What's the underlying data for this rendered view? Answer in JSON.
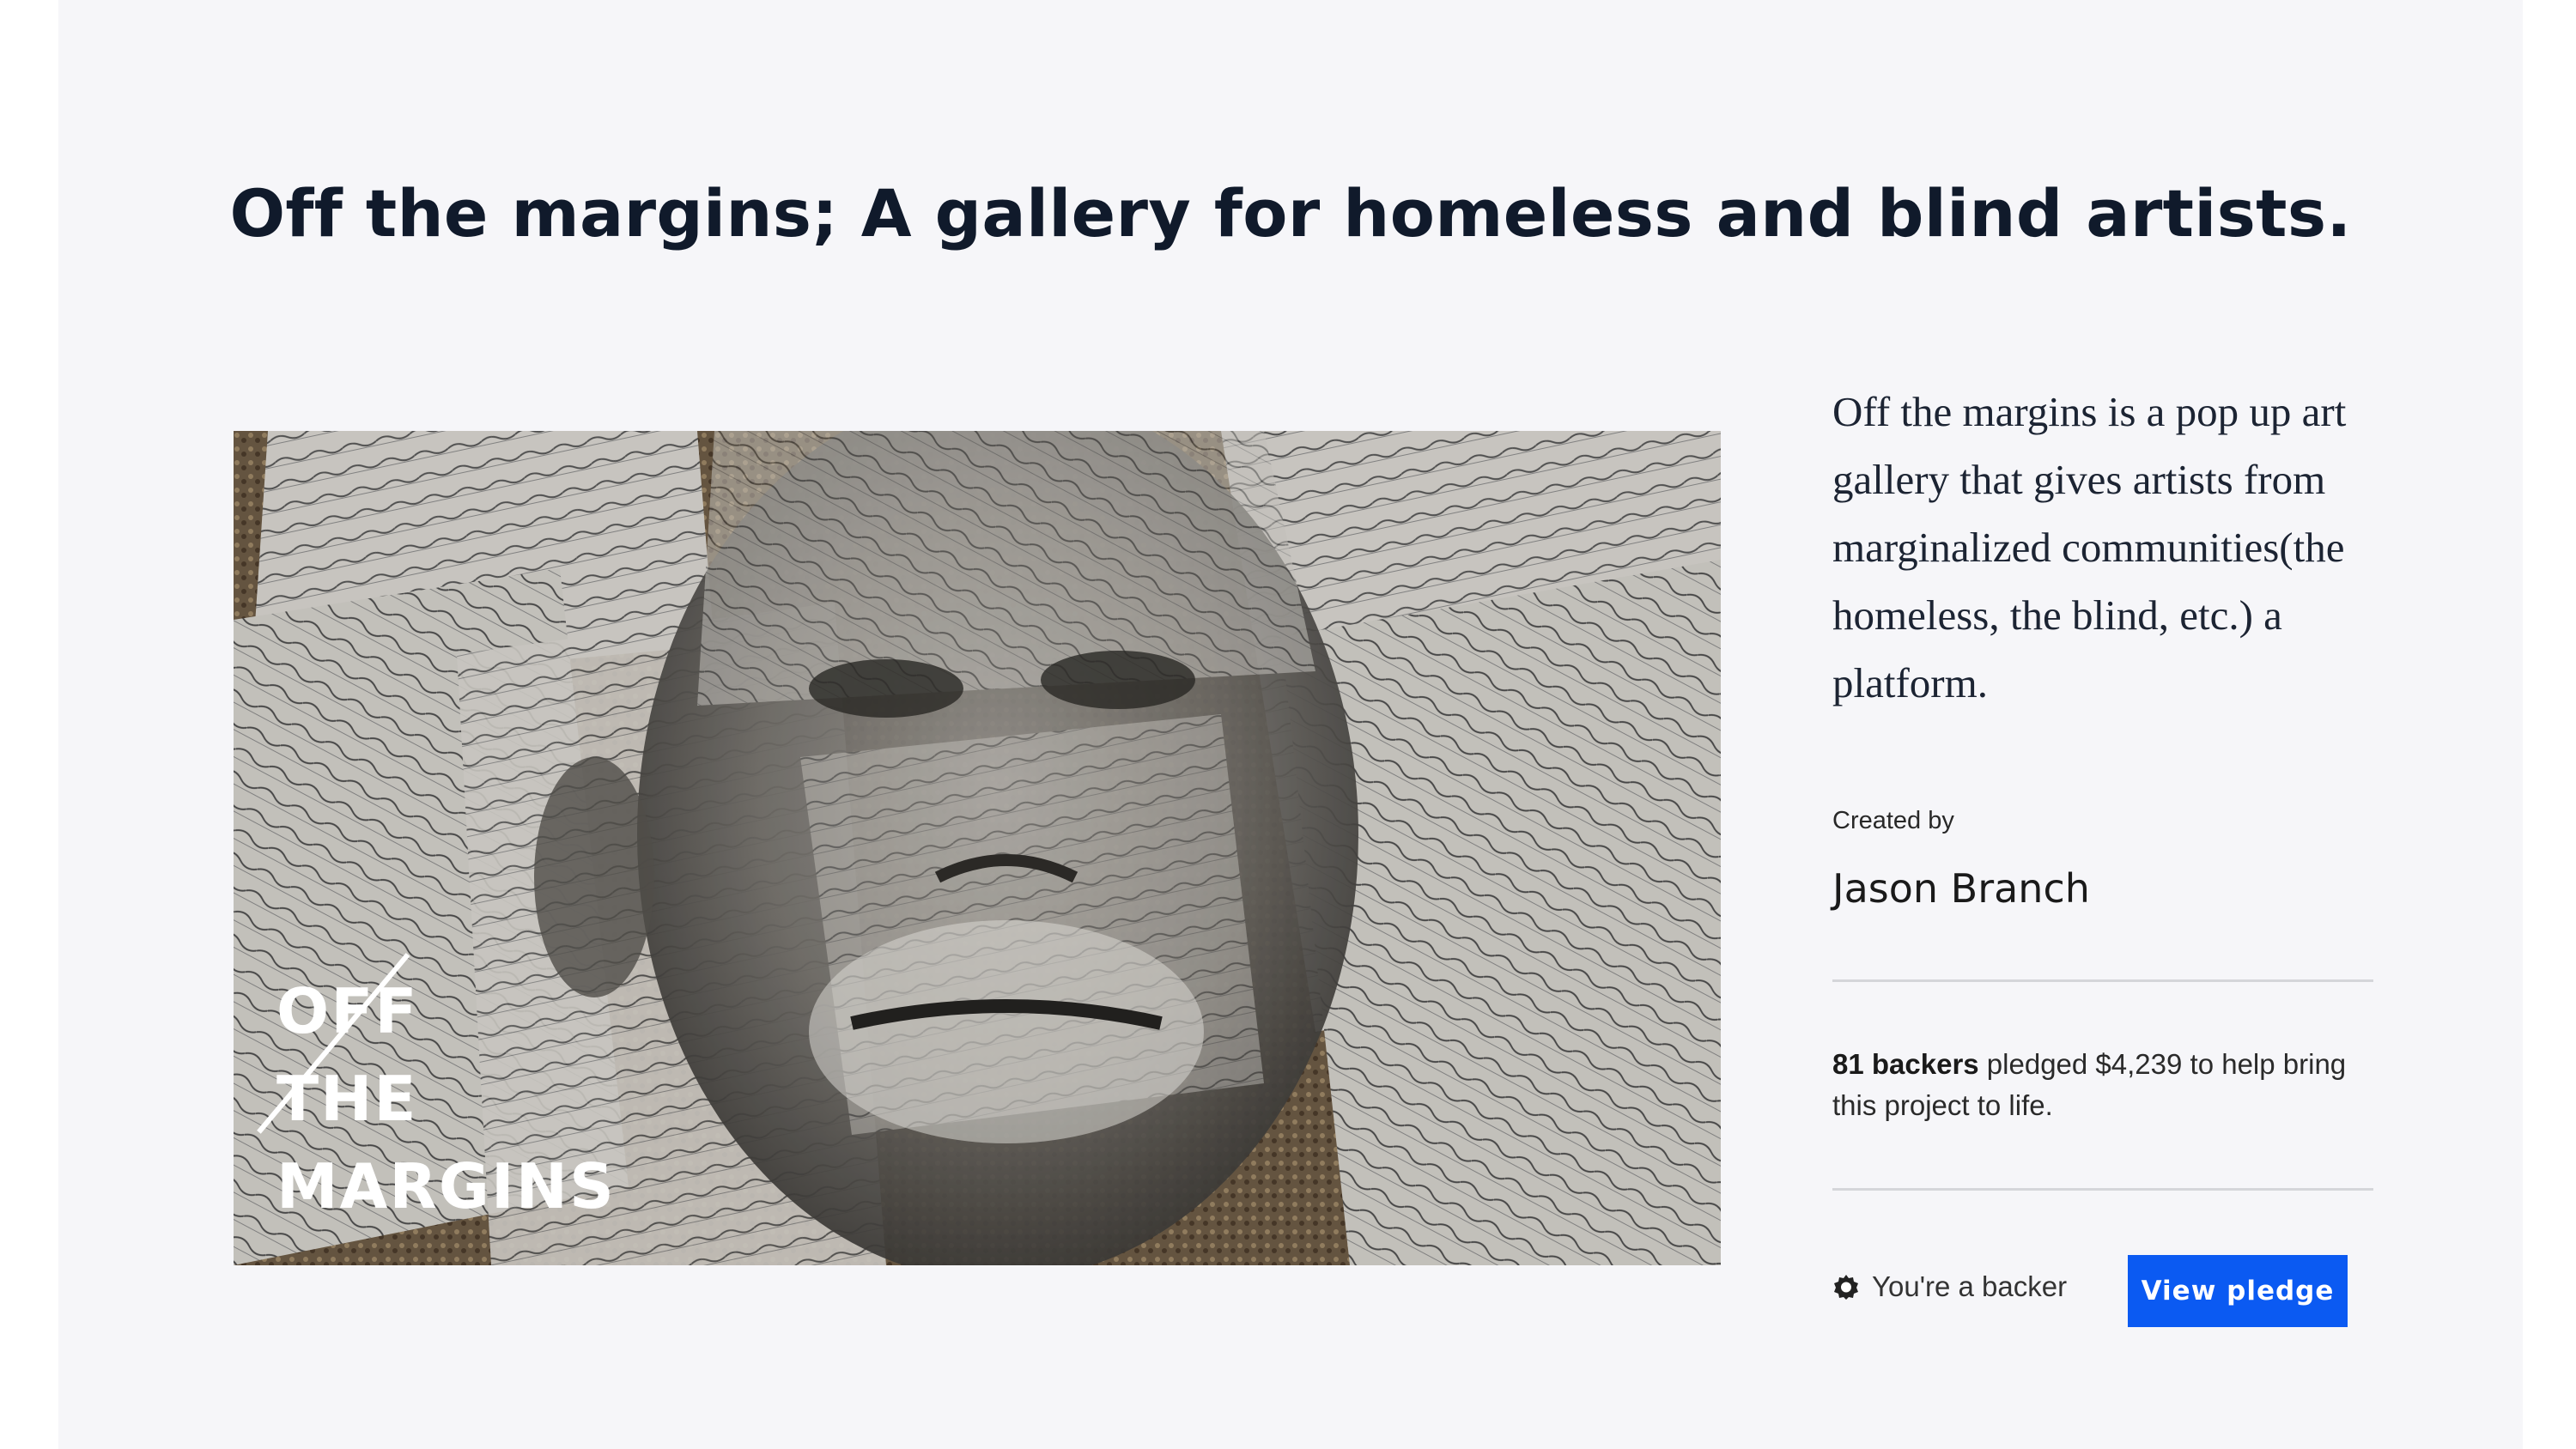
{
  "project": {
    "title": "Off the margins; A gallery for homeless and blind artists.",
    "blurb": "Off the margins is a pop up art gallery that gives artists from marginalized communities(the homeless, the blind, etc.) a platform.",
    "created_by_label": "Created by",
    "creator_name": "Jason Branch"
  },
  "media": {
    "logo_line1": "OFF",
    "logo_line2": "THE",
    "logo_line3": "MARGINS"
  },
  "funding": {
    "backers_count": "81 backers",
    "pledge_text": " pledged $4,239 to help bring this project to life."
  },
  "backer": {
    "status_label": "You're a backer",
    "status_icon": "check-badge-icon",
    "button_label": "View pledge"
  },
  "colors": {
    "accent": "#0b5af2",
    "background": "#f6f6f9",
    "text": "#101a2b"
  }
}
